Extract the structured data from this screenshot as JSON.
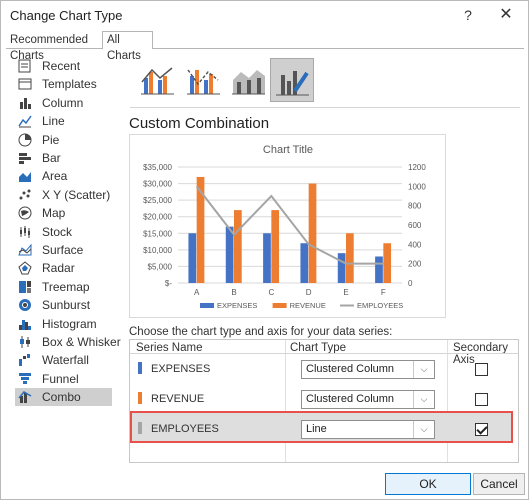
{
  "dialog": {
    "title": "Change Chart Type",
    "help": "?",
    "close": "✕"
  },
  "tabs": [
    "Recommended Charts",
    "All Charts"
  ],
  "sidebar": {
    "items": [
      {
        "label": "Recent",
        "icon": "recent-icon"
      },
      {
        "label": "Templates",
        "icon": "templates-icon"
      },
      {
        "label": "Column",
        "icon": "column-chart-icon"
      },
      {
        "label": "Line",
        "icon": "line-chart-icon"
      },
      {
        "label": "Pie",
        "icon": "pie-chart-icon"
      },
      {
        "label": "Bar",
        "icon": "bar-chart-icon"
      },
      {
        "label": "Area",
        "icon": "area-chart-icon"
      },
      {
        "label": "X Y (Scatter)",
        "icon": "scatter-chart-icon"
      },
      {
        "label": "Map",
        "icon": "map-chart-icon"
      },
      {
        "label": "Stock",
        "icon": "stock-chart-icon"
      },
      {
        "label": "Surface",
        "icon": "surface-chart-icon"
      },
      {
        "label": "Radar",
        "icon": "radar-chart-icon"
      },
      {
        "label": "Treemap",
        "icon": "treemap-chart-icon"
      },
      {
        "label": "Sunburst",
        "icon": "sunburst-chart-icon"
      },
      {
        "label": "Histogram",
        "icon": "histogram-chart-icon"
      },
      {
        "label": "Box & Whisker",
        "icon": "box-whisker-chart-icon"
      },
      {
        "label": "Waterfall",
        "icon": "waterfall-chart-icon"
      },
      {
        "label": "Funnel",
        "icon": "funnel-chart-icon"
      },
      {
        "label": "Combo",
        "icon": "combo-chart-icon",
        "selected": true
      }
    ]
  },
  "section_title": "Custom Combination",
  "instructions": "Choose the chart type and axis for your data series:",
  "series_table": {
    "headers": [
      "Series Name",
      "Chart Type",
      "Secondary Axis"
    ],
    "rows": [
      {
        "name": "EXPENSES",
        "chart_type": "Clustered Column",
        "secondary_axis": false,
        "color": "#4472c4"
      },
      {
        "name": "REVENUE",
        "chart_type": "Clustered Column",
        "secondary_axis": false,
        "color": "#ed7d31"
      },
      {
        "name": "EMPLOYEES",
        "chart_type": "Line",
        "secondary_axis": true,
        "color": "#a5a5a5"
      }
    ]
  },
  "buttons": {
    "ok": "OK",
    "cancel": "Cancel"
  },
  "chart_data": {
    "type": "bar",
    "title": "Chart Title",
    "categories": [
      "A",
      "B",
      "C",
      "D",
      "E",
      "F"
    ],
    "series": [
      {
        "name": "EXPENSES",
        "type": "bar",
        "axis": "primary",
        "color": "#4472c4",
        "values": [
          15000,
          17000,
          15000,
          12000,
          9000,
          8000
        ]
      },
      {
        "name": "REVENUE",
        "type": "bar",
        "axis": "primary",
        "color": "#ed7d31",
        "values": [
          32000,
          22000,
          22000,
          30000,
          15000,
          12000
        ]
      },
      {
        "name": "EMPLOYEES",
        "type": "line",
        "axis": "secondary",
        "color": "#a5a5a5",
        "values": [
          1000,
          500,
          900,
          400,
          200,
          200
        ]
      }
    ],
    "y_primary": {
      "ylim": [
        0,
        35000
      ],
      "ticks": [
        "$-",
        "$5,000",
        "$10,000",
        "$15,000",
        "$20,000",
        "$25,000",
        "$30,000",
        "$35,000"
      ]
    },
    "y_secondary": {
      "ylim": [
        0,
        1200
      ],
      "ticks": [
        "0",
        "200",
        "400",
        "600",
        "800",
        "1000",
        "1200"
      ]
    },
    "legend": "bottom"
  }
}
